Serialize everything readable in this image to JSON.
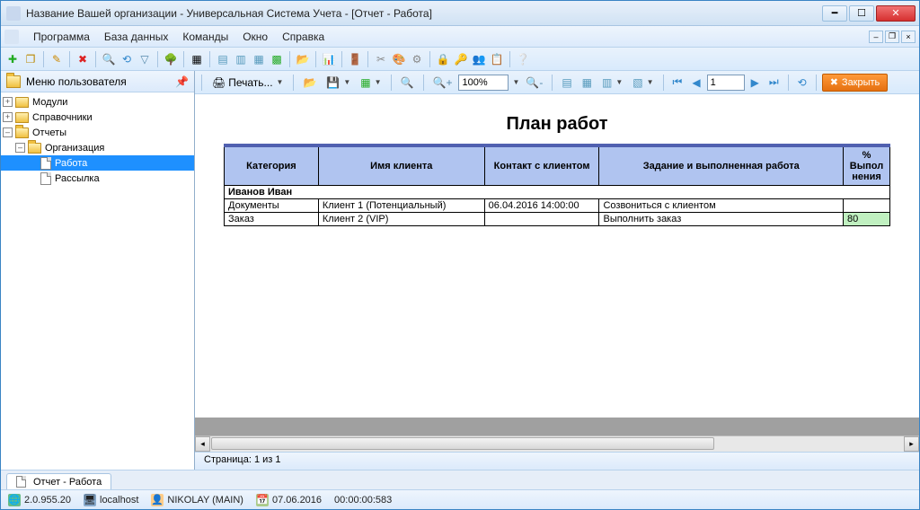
{
  "window_title": "Название Вашей организации - Универсальная Система Учета - [Отчет - Работа]",
  "menu": {
    "program": "Программа",
    "database": "База данных",
    "commands": "Команды",
    "window": "Окно",
    "help": "Справка"
  },
  "sidebar": {
    "title": "Меню пользователя",
    "items": {
      "modules": "Модули",
      "references": "Справочники",
      "reports": "Отчеты",
      "organization": "Организация",
      "work": "Работа",
      "mailing": "Рассылка"
    }
  },
  "report_toolbar": {
    "print": "Печать...",
    "zoom": "100%",
    "page": "1",
    "close": "Закрыть"
  },
  "report": {
    "title": "План работ",
    "headers": {
      "category": "Категория",
      "client": "Имя клиента",
      "contact": "Контакт с клиентом",
      "task": "Задание и выполненная работа",
      "pct": "% Выпол нения"
    },
    "group": "Иванов Иван",
    "rows": [
      {
        "category": "Документы",
        "client": "Клиент 1 (Потенциальный)",
        "contact": "06.04.2016 14:00:00",
        "task": "Созвониться с клиентом",
        "pct": ""
      },
      {
        "category": "Заказ",
        "client": "Клиент 2 (VIP)",
        "contact": "",
        "task": "Выполнить заказ",
        "pct": "80"
      }
    ],
    "page_status": "Страница: 1 из 1"
  },
  "tabs": {
    "report_work": "Отчет - Работа"
  },
  "status": {
    "version": "2.0.955.20",
    "host": "localhost",
    "user": "NIKOLAY (MAIN)",
    "date": "07.06.2016",
    "time": "00:00:00:583"
  }
}
